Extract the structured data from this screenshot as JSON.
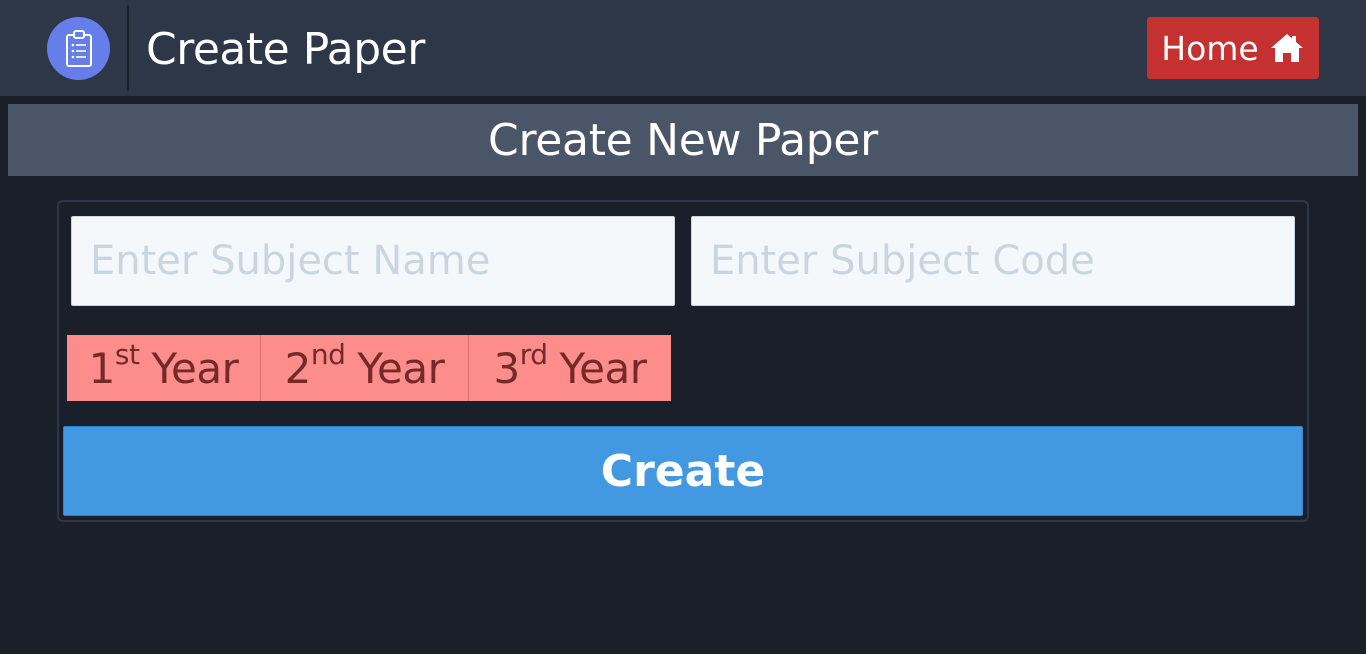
{
  "header": {
    "logo_icon": "clipboard-list-icon",
    "title": "Create Paper",
    "home_button": {
      "label": "Home",
      "icon": "home-icon",
      "color": "#c53030"
    }
  },
  "section": {
    "heading": "Create New Paper"
  },
  "form": {
    "subject_name": {
      "value": "",
      "placeholder": "Enter Subject Name"
    },
    "subject_code": {
      "value": "",
      "placeholder": "Enter Subject Code"
    },
    "year_options": [
      {
        "number": "1",
        "suffix": "st",
        "label": "Year"
      },
      {
        "number": "2",
        "suffix": "nd",
        "label": "Year"
      },
      {
        "number": "3",
        "suffix": "rd",
        "label": "Year"
      }
    ],
    "submit_label": "Create"
  },
  "colors": {
    "background": "#1b1f2a",
    "topbar": "#2d3748",
    "section_header": "#4a5568",
    "logo_accent": "#667eea",
    "year_button": "#fc8d8a",
    "submit_button": "#4299e1"
  }
}
